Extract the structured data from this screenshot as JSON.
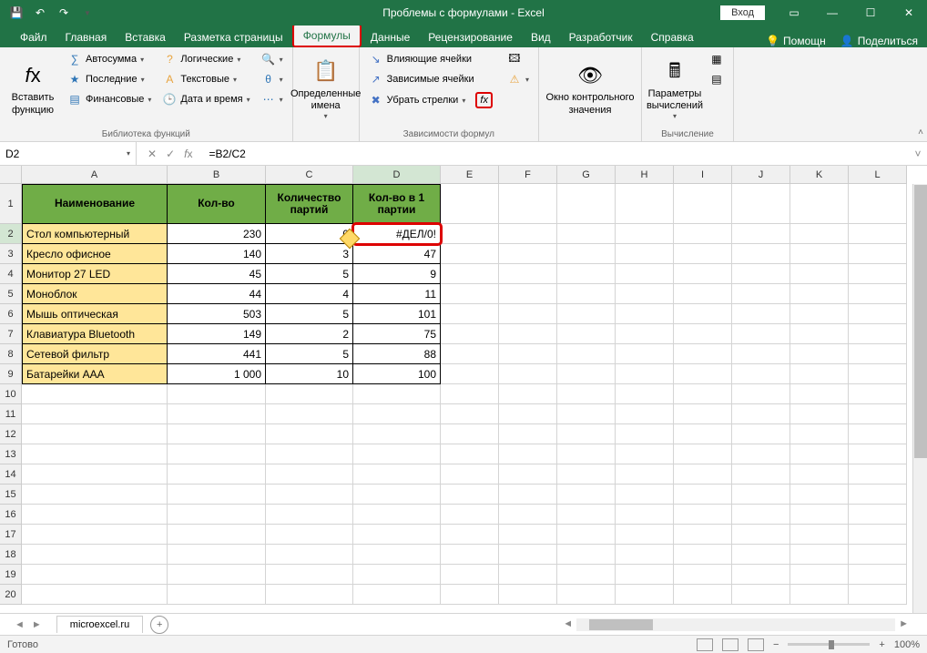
{
  "title": "Проблемы с формулами  -  Excel",
  "login": "Вход",
  "tabs": {
    "file": "Файл",
    "home": "Главная",
    "insert": "Вставка",
    "layout": "Разметка страницы",
    "formulas": "Формулы",
    "data": "Данные",
    "review": "Рецензирование",
    "view": "Вид",
    "developer": "Разработчик",
    "help": "Справка",
    "assist": "Помощн",
    "share": "Поделиться"
  },
  "ribbon": {
    "insert_fn": "Вставить\nфункцию",
    "autosum": "Автосумма",
    "recent": "Последние",
    "financial": "Финансовые",
    "logical": "Логические",
    "text": "Текстовые",
    "datetime": "Дата и время",
    "lookup": "",
    "math": "",
    "more": "",
    "group_lib": "Библиотека функций",
    "defined_names": "Определенные\nимена",
    "trace_prec": "Влияющие ячейки",
    "trace_dep": "Зависимые ячейки",
    "remove_arrows": "Убрать стрелки",
    "group_audit": "Зависимости формул",
    "watch": "Окно контрольного\nзначения",
    "calc_opts": "Параметры\nвычислений",
    "group_calc": "Вычисление"
  },
  "namebox": "D2",
  "formula": "=B2/C2",
  "columns": [
    "A",
    "B",
    "C",
    "D",
    "E",
    "F",
    "G",
    "H",
    "I",
    "J",
    "K",
    "L"
  ],
  "headers": [
    "Наименование",
    "Кол-во",
    "Количество партий",
    "Кол-во в 1 партии"
  ],
  "rows": [
    {
      "n": "Стол компьютерный",
      "q": "230",
      "p": "0",
      "r": "#ДЕЛ/0!"
    },
    {
      "n": "Кресло офисное",
      "q": "140",
      "p": "3",
      "r": "47"
    },
    {
      "n": "Монитор 27 LED",
      "q": "45",
      "p": "5",
      "r": "9"
    },
    {
      "n": "Моноблок",
      "q": "44",
      "p": "4",
      "r": "11"
    },
    {
      "n": "Мышь оптическая",
      "q": "503",
      "p": "5",
      "r": "101"
    },
    {
      "n": "Клавиатура Bluetooth",
      "q": "149",
      "p": "2",
      "r": "75"
    },
    {
      "n": "Сетевой фильтр",
      "q": "441",
      "p": "5",
      "r": "88"
    },
    {
      "n": "Батарейки AAA",
      "q": "1 000",
      "p": "10",
      "r": "100"
    }
  ],
  "sheet": "microexcel.ru",
  "status": "Готово",
  "zoom": "100%"
}
